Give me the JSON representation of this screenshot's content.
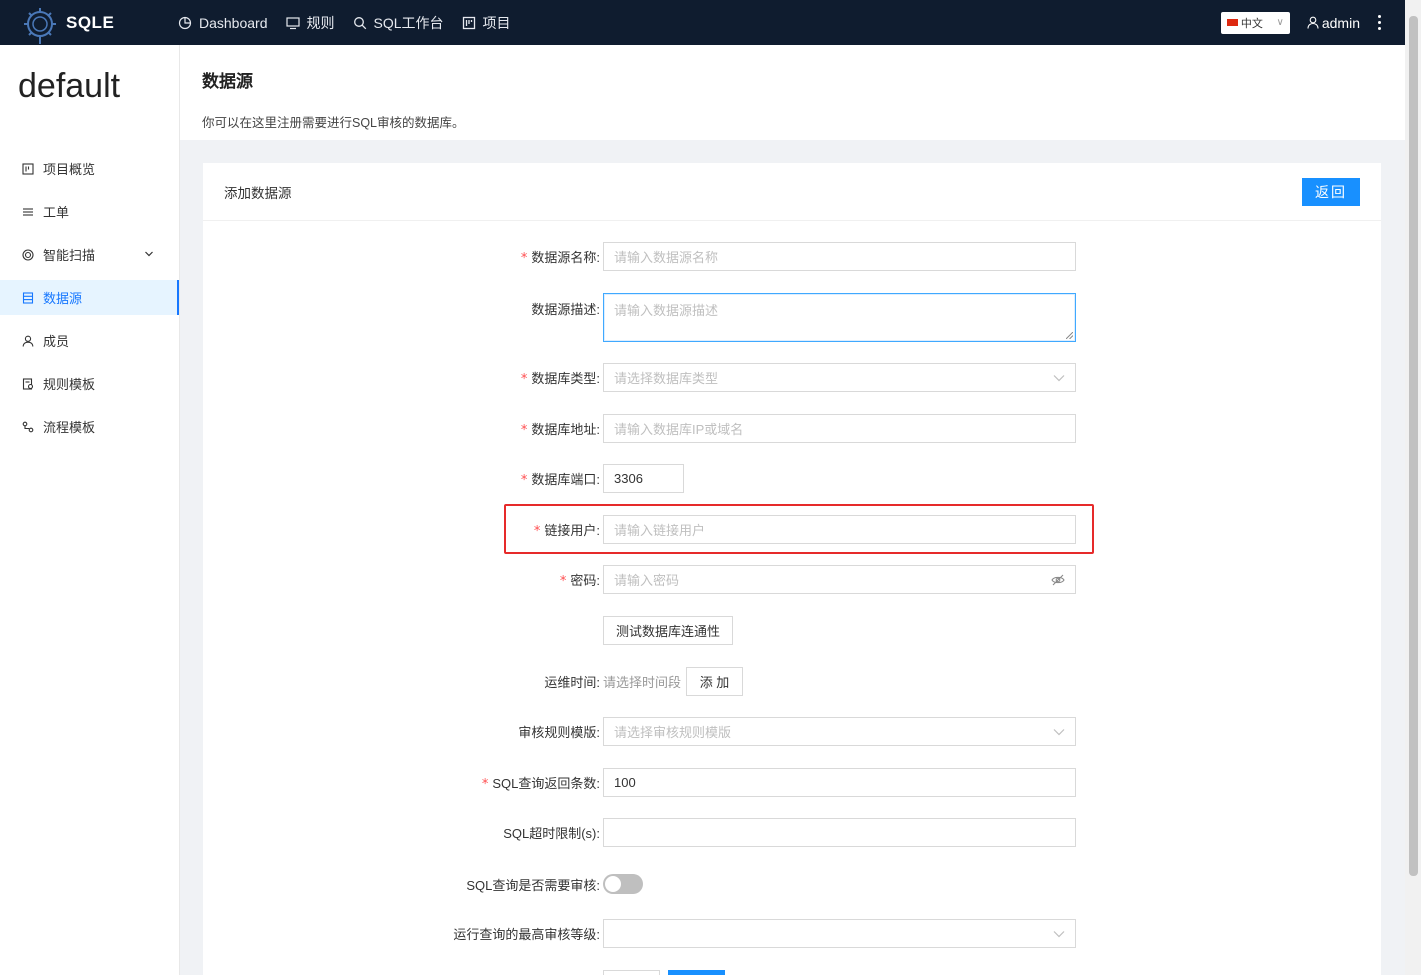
{
  "topbar": {
    "logo_text": "SQLE",
    "nav": [
      {
        "label": "Dashboard",
        "icon": "pie-chart-icon"
      },
      {
        "label": "规则",
        "icon": "monitor-icon"
      },
      {
        "label": "SQL工作台",
        "icon": "search-icon"
      },
      {
        "label": "项目",
        "icon": "project-icon"
      }
    ],
    "language": "中文",
    "user": "admin"
  },
  "sidebar": {
    "project_name": "default",
    "items": [
      {
        "label": "项目概览",
        "icon": "project-overview-icon"
      },
      {
        "label": "工单",
        "icon": "list-icon"
      },
      {
        "label": "智能扫描",
        "icon": "scan-icon"
      },
      {
        "label": "数据源",
        "icon": "database-icon",
        "active": true
      },
      {
        "label": "成员",
        "icon": "user-icon"
      },
      {
        "label": "规则模板",
        "icon": "rule-template-icon"
      },
      {
        "label": "流程模板",
        "icon": "flow-template-icon"
      }
    ]
  },
  "header": {
    "title": "数据源",
    "description": "你可以在这里注册需要进行SQL审核的数据库。"
  },
  "card": {
    "title": "添加数据源",
    "back_label": "返回"
  },
  "form": {
    "name": {
      "label": "数据源名称:",
      "placeholder": "请输入数据源名称"
    },
    "desc": {
      "label": "数据源描述:",
      "placeholder": "请输入数据源描述"
    },
    "db_type": {
      "label": "数据库类型:",
      "placeholder": "请选择数据库类型"
    },
    "host": {
      "label": "数据库地址:",
      "placeholder": "请输入数据库IP或域名"
    },
    "port": {
      "label": "数据库端口:",
      "value": "3306"
    },
    "user": {
      "label": "链接用户:",
      "placeholder": "请输入链接用户"
    },
    "password": {
      "label": "密码:",
      "placeholder": "请输入密码"
    },
    "test_button": "测试数据库连通性",
    "maintenance": {
      "label": "运维时间:",
      "placeholder": "请选择时间段",
      "add_label": "添 加"
    },
    "rule_template": {
      "label": "审核规则模版:",
      "placeholder": "请选择审核规则模版"
    },
    "sql_rows": {
      "label": "SQL查询返回条数:",
      "value": "100"
    },
    "sql_timeout": {
      "label": "SQL超时限制(s):",
      "value": ""
    },
    "need_audit": {
      "label": "SQL查询是否需要审核:",
      "enabled": false
    },
    "max_level": {
      "label": "运行查询的最高审核等级:",
      "value": ""
    }
  }
}
